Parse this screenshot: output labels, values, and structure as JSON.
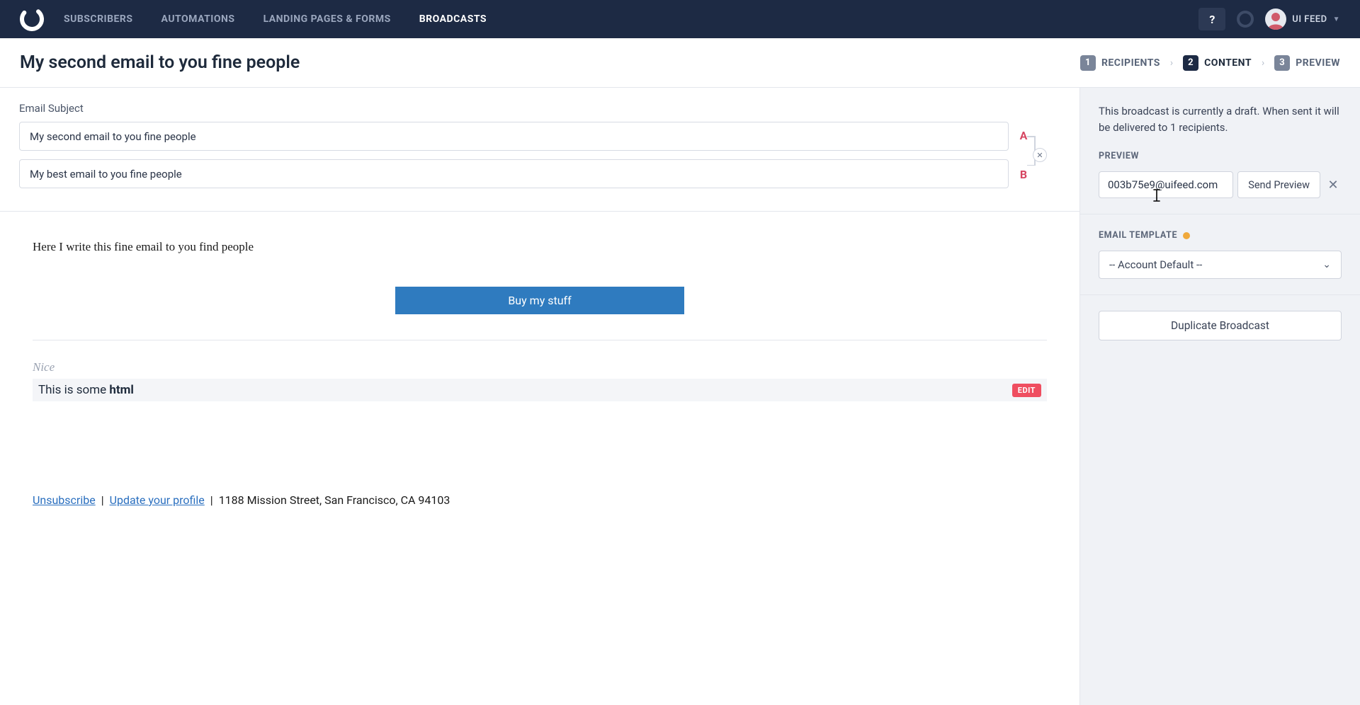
{
  "nav": {
    "items": [
      {
        "label": "Subscribers",
        "active": false
      },
      {
        "label": "Automations",
        "active": false
      },
      {
        "label": "Landing Pages & Forms",
        "active": false
      },
      {
        "label": "Broadcasts",
        "active": true
      }
    ],
    "help": "?",
    "user_label": "UI FEED"
  },
  "header": {
    "title": "My second email to you fine people",
    "steps": [
      {
        "num": "1",
        "label": "Recipients",
        "active": false
      },
      {
        "num": "2",
        "label": "Content",
        "active": true
      },
      {
        "num": "3",
        "label": "Preview",
        "active": false
      }
    ]
  },
  "subject": {
    "label": "Email Subject",
    "A": "My second email to you fine people",
    "B": "My best email to you fine people",
    "variantA": "A",
    "variantB": "B"
  },
  "editor": {
    "paragraph": "Here I write this fine email to you find people",
    "cta": "Buy my stuff",
    "nice": "Nice",
    "html_prefix": "This is some ",
    "html_bold": "html",
    "edit": "EDIT"
  },
  "footer": {
    "unsubscribe": "Unsubscribe",
    "update": "Update your profile",
    "address": "1188 Mission Street, San Francisco, CA 94103"
  },
  "sidebar": {
    "draft_text": "This broadcast is currently a draft. When sent it will be delivered to 1 recipients.",
    "preview_heading": "PREVIEW",
    "preview_email": "003b75e9@uifeed.com",
    "send_preview": "Send Preview",
    "template_heading": "EMAIL TEMPLATE",
    "template_value": "-- Account Default --",
    "duplicate": "Duplicate Broadcast"
  }
}
